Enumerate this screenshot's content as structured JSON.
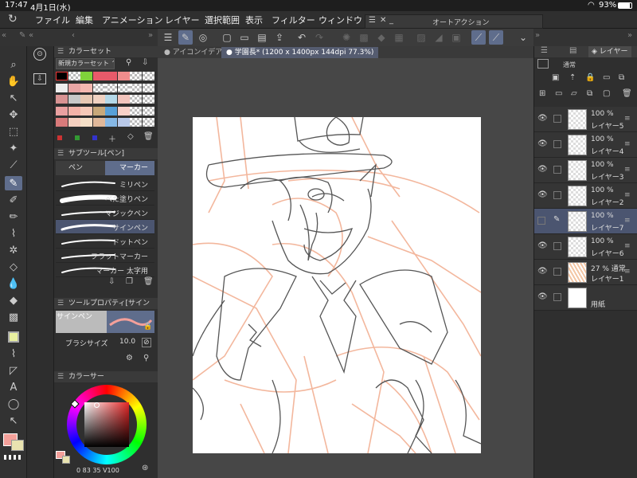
{
  "status": {
    "time": "17:47",
    "date": "4月1日(水)",
    "battery": "93%"
  },
  "menu": [
    "ファイル",
    "編集",
    "アニメーション",
    "レイヤー",
    "選択範囲",
    "表示",
    "フィルター",
    "ウィンドウ"
  ],
  "autoaction": {
    "title": "オートアクション"
  },
  "doc_tabs": {
    "tab1": "アイコンイデア",
    "tab2": "学園長* (1200 x 1400px 144dpi 77.3%)"
  },
  "colorset": {
    "title": "カラーセット",
    "set_name": "新規カラーセット"
  },
  "subtool": {
    "title": "サブツール[ペン]",
    "tab_pen": "ペン",
    "tab_marker": "マーカー",
    "brushes": [
      "ミリペン",
      "べた塗りペン",
      "マジックペン",
      "サインペン",
      "ドットペン",
      "フラットマーカー",
      "マーカー 太字用"
    ]
  },
  "toolprop": {
    "title": "ツールプロパティ[サイン",
    "brush_name": "サインペン",
    "size_label": "ブラシサイズ",
    "size_value": "10.0"
  },
  "colorpanel": {
    "title": "カラーサー",
    "values": "0  83  35  V100"
  },
  "layers": {
    "title": "レイヤー",
    "blend": "通常",
    "items": [
      {
        "pct": "100 %",
        "name": "レイヤー5",
        "selected": false
      },
      {
        "pct": "100 %",
        "name": "レイヤー4",
        "selected": false
      },
      {
        "pct": "100 %",
        "name": "レイヤー3",
        "selected": false
      },
      {
        "pct": "100 %",
        "name": "レイヤー2",
        "selected": false
      },
      {
        "pct": "100 %",
        "name": "レイヤー7",
        "selected": true
      },
      {
        "pct": "100 %",
        "name": "レイヤー6",
        "selected": false
      },
      {
        "pct": "27 % 通常",
        "name": "レイヤー1",
        "selected": false
      },
      {
        "pct": "",
        "name": "用紙",
        "selected": false
      }
    ]
  },
  "colors": {
    "main": "#f4a09a",
    "sub": "#e9e3b0",
    "accent": "#5f6d8c"
  }
}
